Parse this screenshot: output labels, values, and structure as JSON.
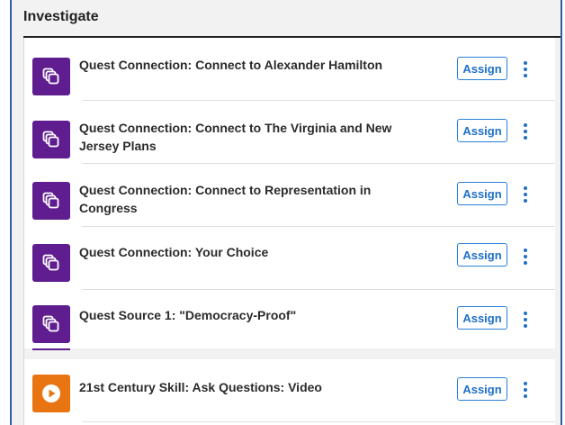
{
  "section": {
    "title": "Investigate"
  },
  "items": [
    {
      "title": "Quest Connection: Connect to Alexander Hamilton",
      "icon": "stacked-cards-icon",
      "icon_color": "#5f1d8f",
      "assign_label": "Assign"
    },
    {
      "title": "Quest Connection: Connect to The Virginia and New Jersey Plans",
      "icon": "stacked-cards-icon",
      "icon_color": "#5f1d8f",
      "assign_label": "Assign"
    },
    {
      "title": "Quest Connection: Connect to Representation in Congress",
      "icon": "stacked-cards-icon",
      "icon_color": "#5f1d8f",
      "assign_label": "Assign"
    },
    {
      "title": "Quest Connection: Your Choice",
      "icon": "stacked-cards-icon",
      "icon_color": "#5f1d8f",
      "assign_label": "Assign"
    },
    {
      "title": "Quest Source 1: \"Democracy-Proof\"",
      "icon": "stacked-cards-icon",
      "icon_color": "#5f1d8f",
      "assign_label": "Assign"
    },
    {
      "title": "21st Century Skill: Ask Questions: Video",
      "icon": "play-video-icon",
      "icon_color": "#e87511",
      "assign_label": "Assign"
    }
  ],
  "colors": {
    "accent": "#1f6fc6",
    "border": "#2f5f9e"
  }
}
